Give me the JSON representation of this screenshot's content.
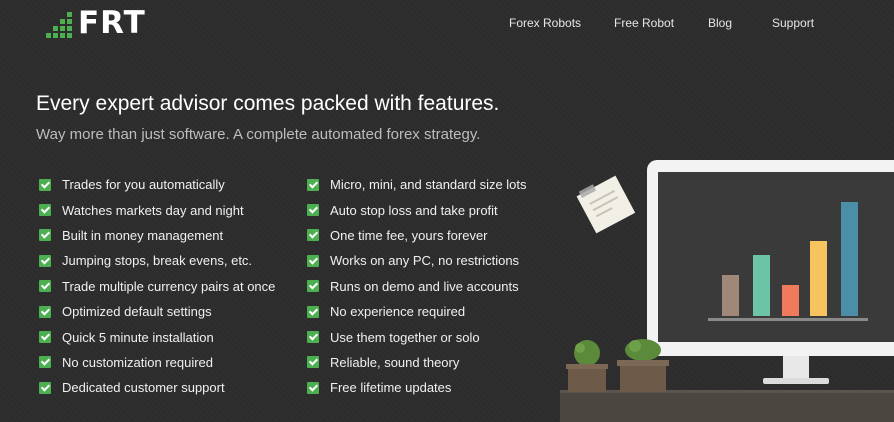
{
  "brand": {
    "logo_text": "FRT"
  },
  "nav": {
    "items": [
      "Forex Robots",
      "Free Robot",
      "Blog",
      "Support"
    ]
  },
  "hero": {
    "title": "Every expert advisor comes packed with features.",
    "subtitle": "Way more than just software. A complete automated forex strategy."
  },
  "features": {
    "left": [
      "Trades for you automatically",
      "Watches markets day and night",
      "Built in money management",
      "Jumping stops, break evens, etc.",
      "Trade multiple currency pairs at once",
      "Optimized default settings",
      "Quick 5 minute installation",
      "No customization required",
      "Dedicated customer support"
    ],
    "right": [
      "Micro, mini, and standard size lots",
      "Auto stop loss and take profit",
      "One time fee, yours forever",
      "Works on any PC, no restrictions",
      "Runs on demo and live accounts",
      "No experience required",
      "Use them together or solo",
      "Reliable, sound theory",
      "Free lifetime updates"
    ]
  },
  "colors": {
    "accent": "#4caf50",
    "background": "#2d2d2d",
    "bars": [
      "#a08878",
      "#6cc3a5",
      "#f07a5e",
      "#f7c35e",
      "#4b8ea8"
    ]
  }
}
